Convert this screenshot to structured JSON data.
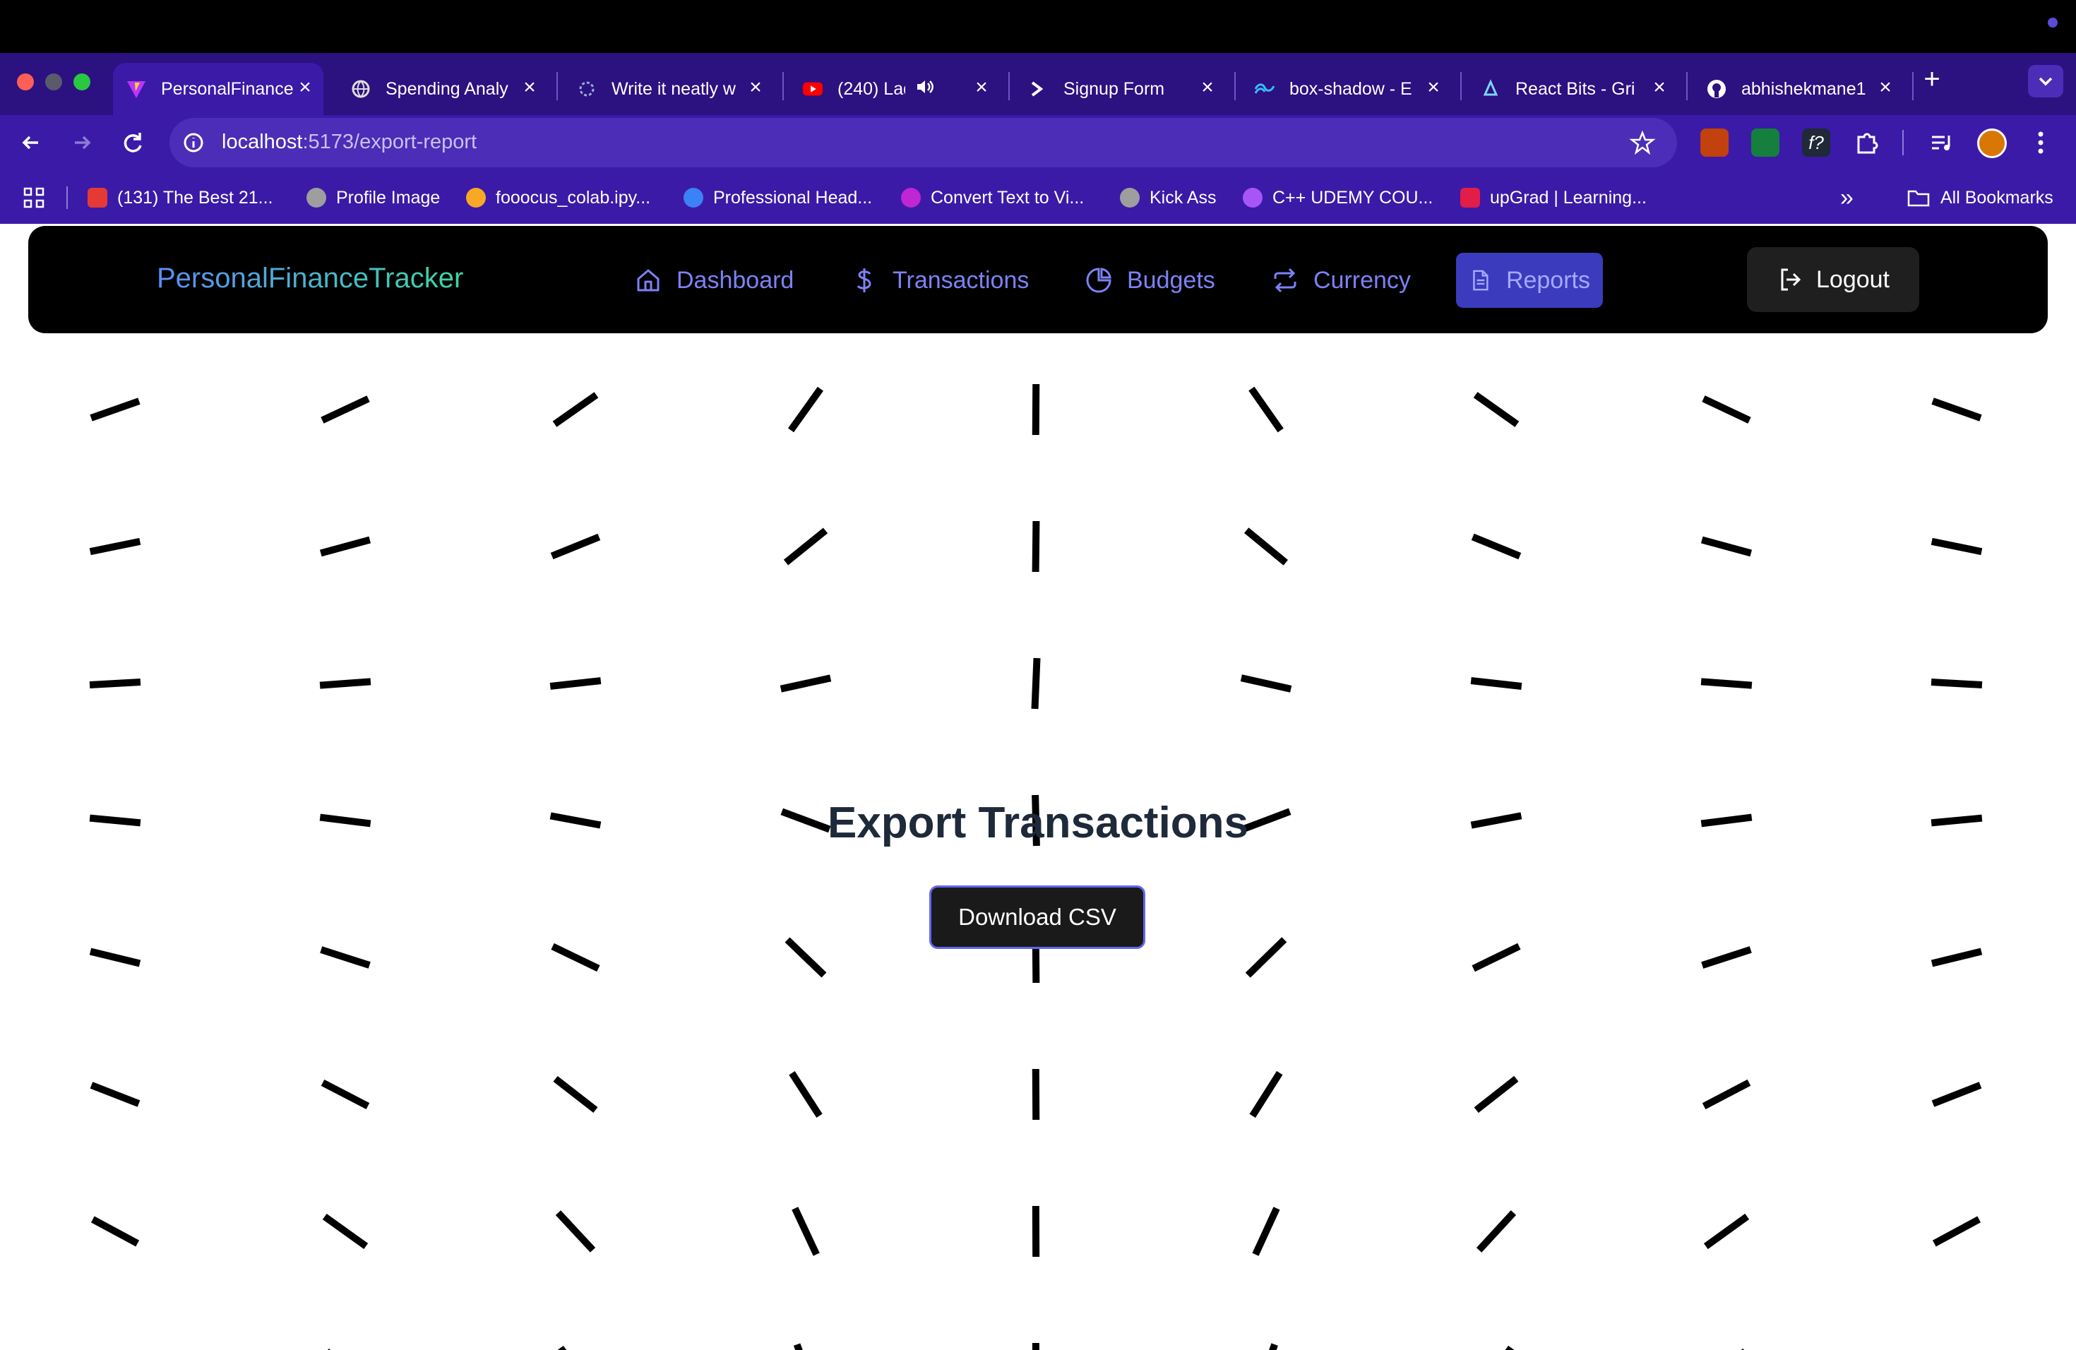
{
  "browser": {
    "tabs": [
      {
        "title": "PersonalFinance",
        "icon": "vite-icon",
        "active": true
      },
      {
        "title": "Spending Analy",
        "icon": "globe-icon"
      },
      {
        "title": "Write it neatly w",
        "icon": "openai-icon"
      },
      {
        "title": "(240) Lady (",
        "icon": "youtube-icon"
      },
      {
        "title": "Signup Form",
        "icon": "terminal-icon"
      },
      {
        "title": "box-shadow - E",
        "icon": "tailwind-icon"
      },
      {
        "title": "React Bits - Gri",
        "icon": "react-bits-icon"
      },
      {
        "title": "abhishekmane1",
        "icon": "github-icon"
      }
    ],
    "close_glyph": "×",
    "new_tab": "+",
    "url_host": "localhost",
    "url_path": ":5173/export-report",
    "bookmarks": [
      {
        "label": "(131) The Best 21...",
        "color": "#e53935"
      },
      {
        "label": "Profile Image",
        "color": "#9e9e9e"
      },
      {
        "label": "fooocus_colab.ipy...",
        "color": "#f9a825"
      },
      {
        "label": "Professional Head...",
        "color": "#3b82f6"
      },
      {
        "label": "Convert Text to Vi...",
        "color": "#c026d3"
      },
      {
        "label": "Kick Ass",
        "color": "#9e9e9e"
      },
      {
        "label": "C++ UDEMY COU...",
        "color": "#a855f7"
      },
      {
        "label": "upGrad | Learning...",
        "color": "#e11d48"
      }
    ],
    "bookmarks_more": "»",
    "all_bookmarks": "All Bookmarks"
  },
  "app": {
    "brand": "PersonalFinanceTracker",
    "nav": [
      {
        "label": "Dashboard",
        "icon": "home-icon"
      },
      {
        "label": "Transactions",
        "icon": "dollar-icon"
      },
      {
        "label": "Budgets",
        "icon": "pie-chart-icon"
      },
      {
        "label": "Currency",
        "icon": "repeat-icon"
      },
      {
        "label": "Reports",
        "icon": "file-text-icon",
        "active": true
      }
    ],
    "logout": "Logout",
    "heading": "Export Transactions",
    "download_button": "Download CSV",
    "background": "rotating-line-grid"
  }
}
